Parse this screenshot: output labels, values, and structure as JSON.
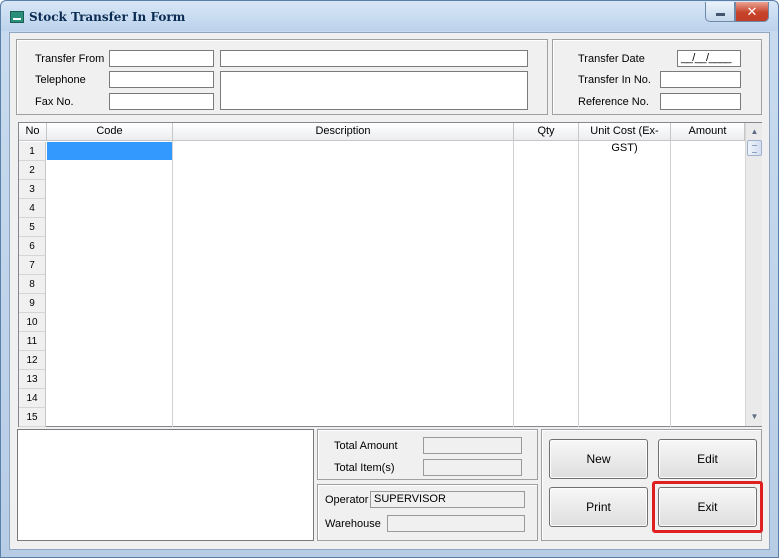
{
  "window": {
    "title": "Stock Transfer In Form",
    "close_glyph": "✕",
    "icon_text": "stpos"
  },
  "header": {
    "transfer_from_label": "Transfer From",
    "telephone_label": "Telephone",
    "fax_label": "Fax No.",
    "transfer_from_code": "",
    "transfer_from_name": "",
    "telephone": "",
    "fax": "",
    "address": "",
    "transfer_date_label": "Transfer Date",
    "transfer_date": "__/__/____",
    "transfer_in_no_label": "Transfer In No.",
    "transfer_in_no": "",
    "reference_no_label": "Reference No.",
    "reference_no": ""
  },
  "grid": {
    "columns": [
      "No",
      "Code",
      "Description",
      "Qty",
      "Unit Cost (Ex-GST)",
      "Amount"
    ],
    "rows": [
      "1",
      "2",
      "3",
      "4",
      "5",
      "6",
      "7",
      "8",
      "9",
      "10",
      "11",
      "12",
      "13",
      "14",
      "15"
    ],
    "scroll_up": "▲",
    "scroll_down": "▼"
  },
  "totals": {
    "total_amount_label": "Total Amount",
    "total_amount": "",
    "total_items_label": "Total Item(s)",
    "total_items": ""
  },
  "info": {
    "operator_label": "Operator",
    "operator": "SUPERVISOR",
    "warehouse_label": "Warehouse",
    "warehouse": ""
  },
  "buttons": {
    "new": "New",
    "edit": "Edit",
    "print": "Print",
    "exit": "Exit"
  },
  "colors": {
    "selection": "#3399ff",
    "highlight": "#e02020",
    "title_text": "#0b2b52"
  }
}
